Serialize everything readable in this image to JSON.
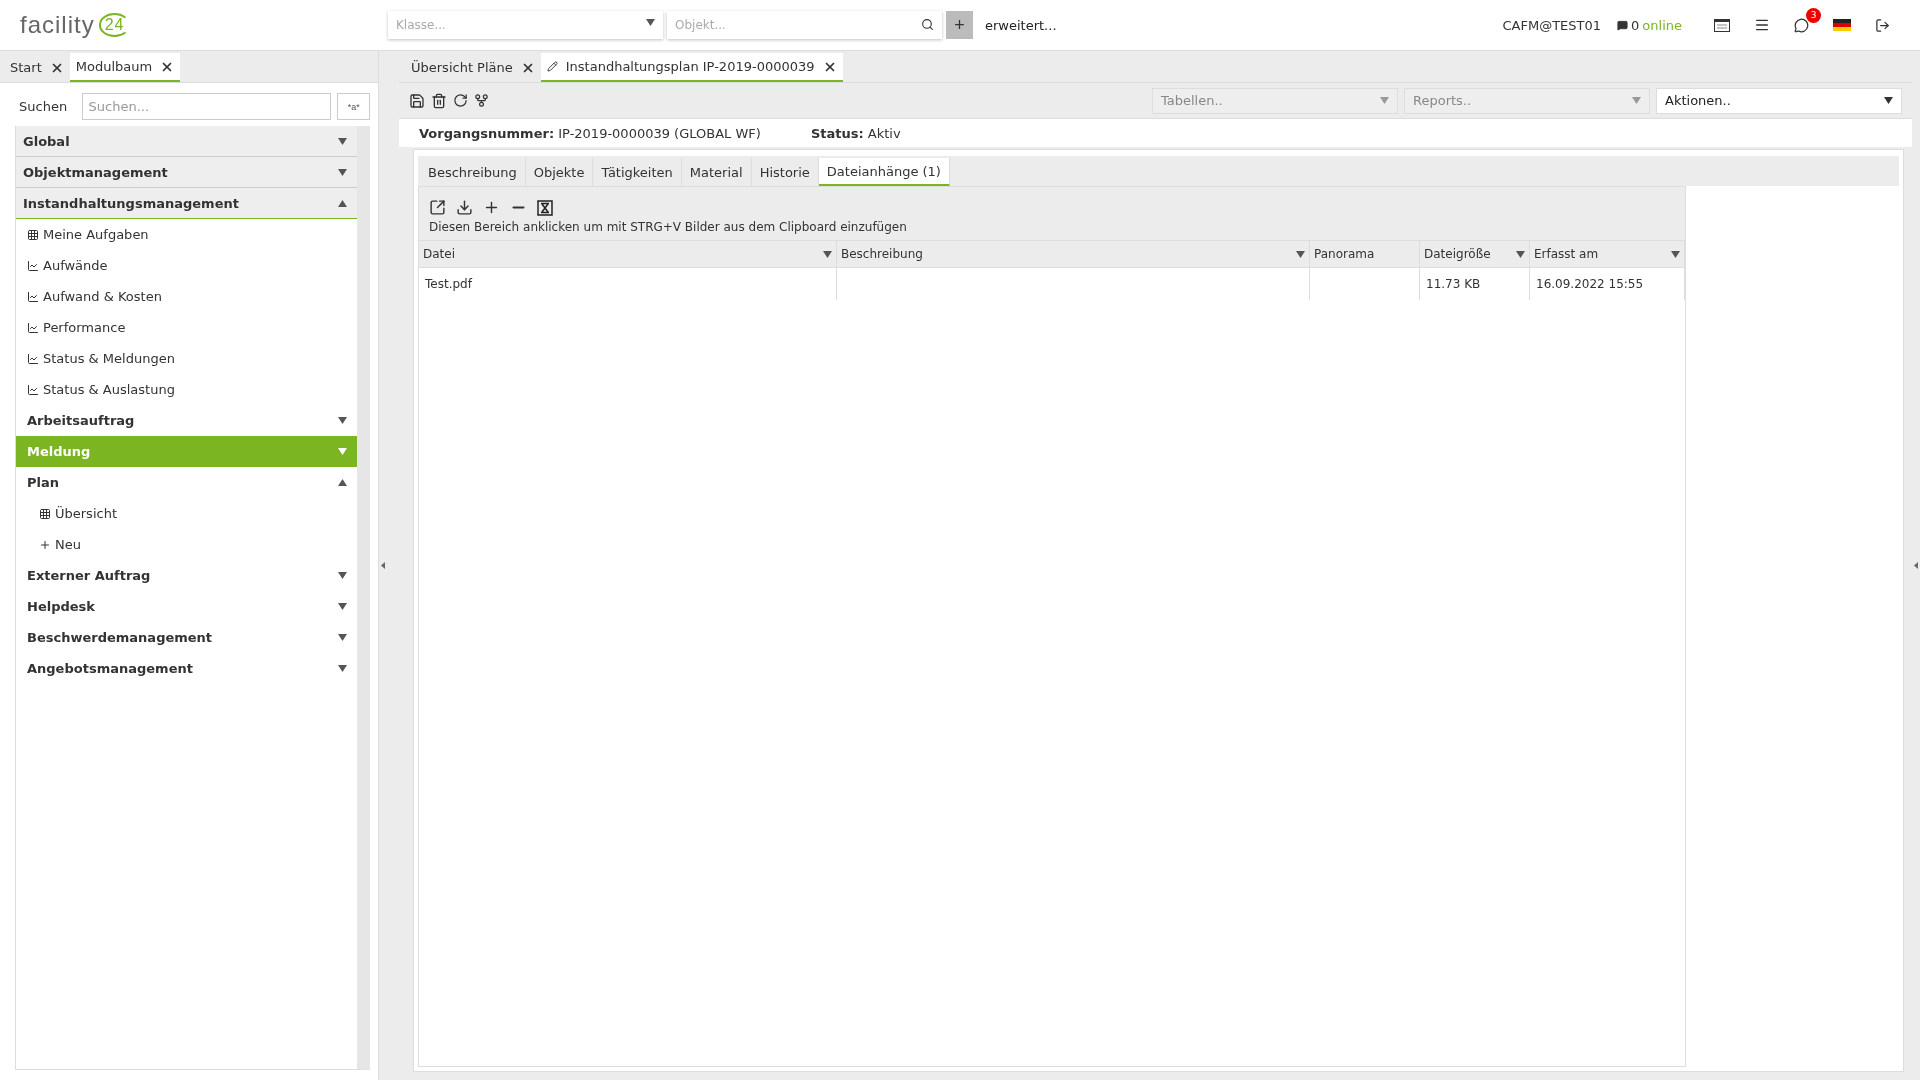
{
  "header": {
    "logo": "facility",
    "logo_badge": "24",
    "class_select": {
      "placeholder": "Klasse..."
    },
    "object_search": {
      "placeholder": "Objekt..."
    },
    "add_button": "+",
    "advanced_link": "erweitert...",
    "user": "CAFM@TEST01",
    "online": {
      "count": "0",
      "label": "online"
    },
    "message_count": "3"
  },
  "left_tabs": [
    {
      "label": "Start",
      "selected": false
    },
    {
      "label": "Modulbaum",
      "selected": true
    }
  ],
  "search": {
    "label": "Suchen",
    "placeholder": "Suchen...",
    "toggle": "*a*"
  },
  "menu": [
    {
      "kind": "section",
      "label": "Global",
      "expanded": false,
      "selected": false
    },
    {
      "kind": "section",
      "label": "Objektmanagement",
      "expanded": false,
      "selected": false
    },
    {
      "kind": "section",
      "label": "Instandhaltungsmanagement",
      "expanded": true,
      "selected": false,
      "children": [
        {
          "kind": "table_link",
          "label": "Meine Aufgaben"
        },
        {
          "kind": "chart_link",
          "label": "Aufwände"
        },
        {
          "kind": "chart_link",
          "label": "Aufwand & Kosten"
        },
        {
          "kind": "chart_link",
          "label": "Performance"
        },
        {
          "kind": "chart_link",
          "label": "Status & Meldungen"
        },
        {
          "kind": "chart_link",
          "label": "Status & Auslastung"
        },
        {
          "kind": "group",
          "label": "Arbeitsauftrag",
          "expanded": false,
          "selected": false
        },
        {
          "kind": "group",
          "label": "Meldung",
          "expanded": false,
          "selected": true
        },
        {
          "kind": "group",
          "label": "Plan",
          "expanded": true,
          "selected": false,
          "children": [
            {
              "kind": "table_link",
              "label": "Übersicht"
            },
            {
              "kind": "new_link",
              "label": "Neu"
            }
          ]
        },
        {
          "kind": "group",
          "label": "Externer Auftrag",
          "expanded": false,
          "selected": false
        },
        {
          "kind": "group",
          "label": "Helpdesk",
          "expanded": false,
          "selected": false
        },
        {
          "kind": "group",
          "label": "Beschwerdemanagement",
          "expanded": false,
          "selected": false
        },
        {
          "kind": "group",
          "label": "Angebotsmanagement",
          "expanded": false,
          "selected": false
        }
      ]
    }
  ],
  "doc_tabs": [
    {
      "label": "Übersicht Pläne",
      "selected": false,
      "edited": false
    },
    {
      "label": "Instandhaltungsplan IP-2019-0000039",
      "selected": true,
      "edited": true
    }
  ],
  "selects": [
    {
      "placeholder": "Tabellen..",
      "disabled": true
    },
    {
      "placeholder": "Reports..",
      "disabled": true
    },
    {
      "placeholder": "Aktionen..",
      "disabled": false
    }
  ],
  "record": {
    "number": "**Vorgangsnummer:** IP-2019-0000039 (GLOBAL WF)",
    "status": "**Status:** Aktiv"
  },
  "detail_tabs": [
    {
      "label": "Beschreibung",
      "selected": false
    },
    {
      "label": "Objekte",
      "selected": false
    },
    {
      "label": "Tätigkeiten",
      "selected": false
    },
    {
      "label": "Material",
      "selected": false
    },
    {
      "label": "Historie",
      "selected": false
    },
    {
      "label": "Dateianhänge (1)",
      "selected": true
    }
  ],
  "attachments": {
    "hint": "Diesen Bereich anklicken um mit STRG+V Bilder aus dem Clipboard einzufügen",
    "columns": [
      {
        "label": "Datei",
        "filter": true
      },
      {
        "label": "Beschreibung",
        "filter": true
      },
      {
        "label": "Panorama",
        "filter": false
      },
      {
        "label": "Dateigröße",
        "filter": true
      },
      {
        "label": "Erfasst am",
        "filter": true
      }
    ],
    "rows": [
      [
        "Test.pdf",
        "",
        "",
        "11.73 KB",
        "16.09.2022 15:55"
      ]
    ]
  }
}
